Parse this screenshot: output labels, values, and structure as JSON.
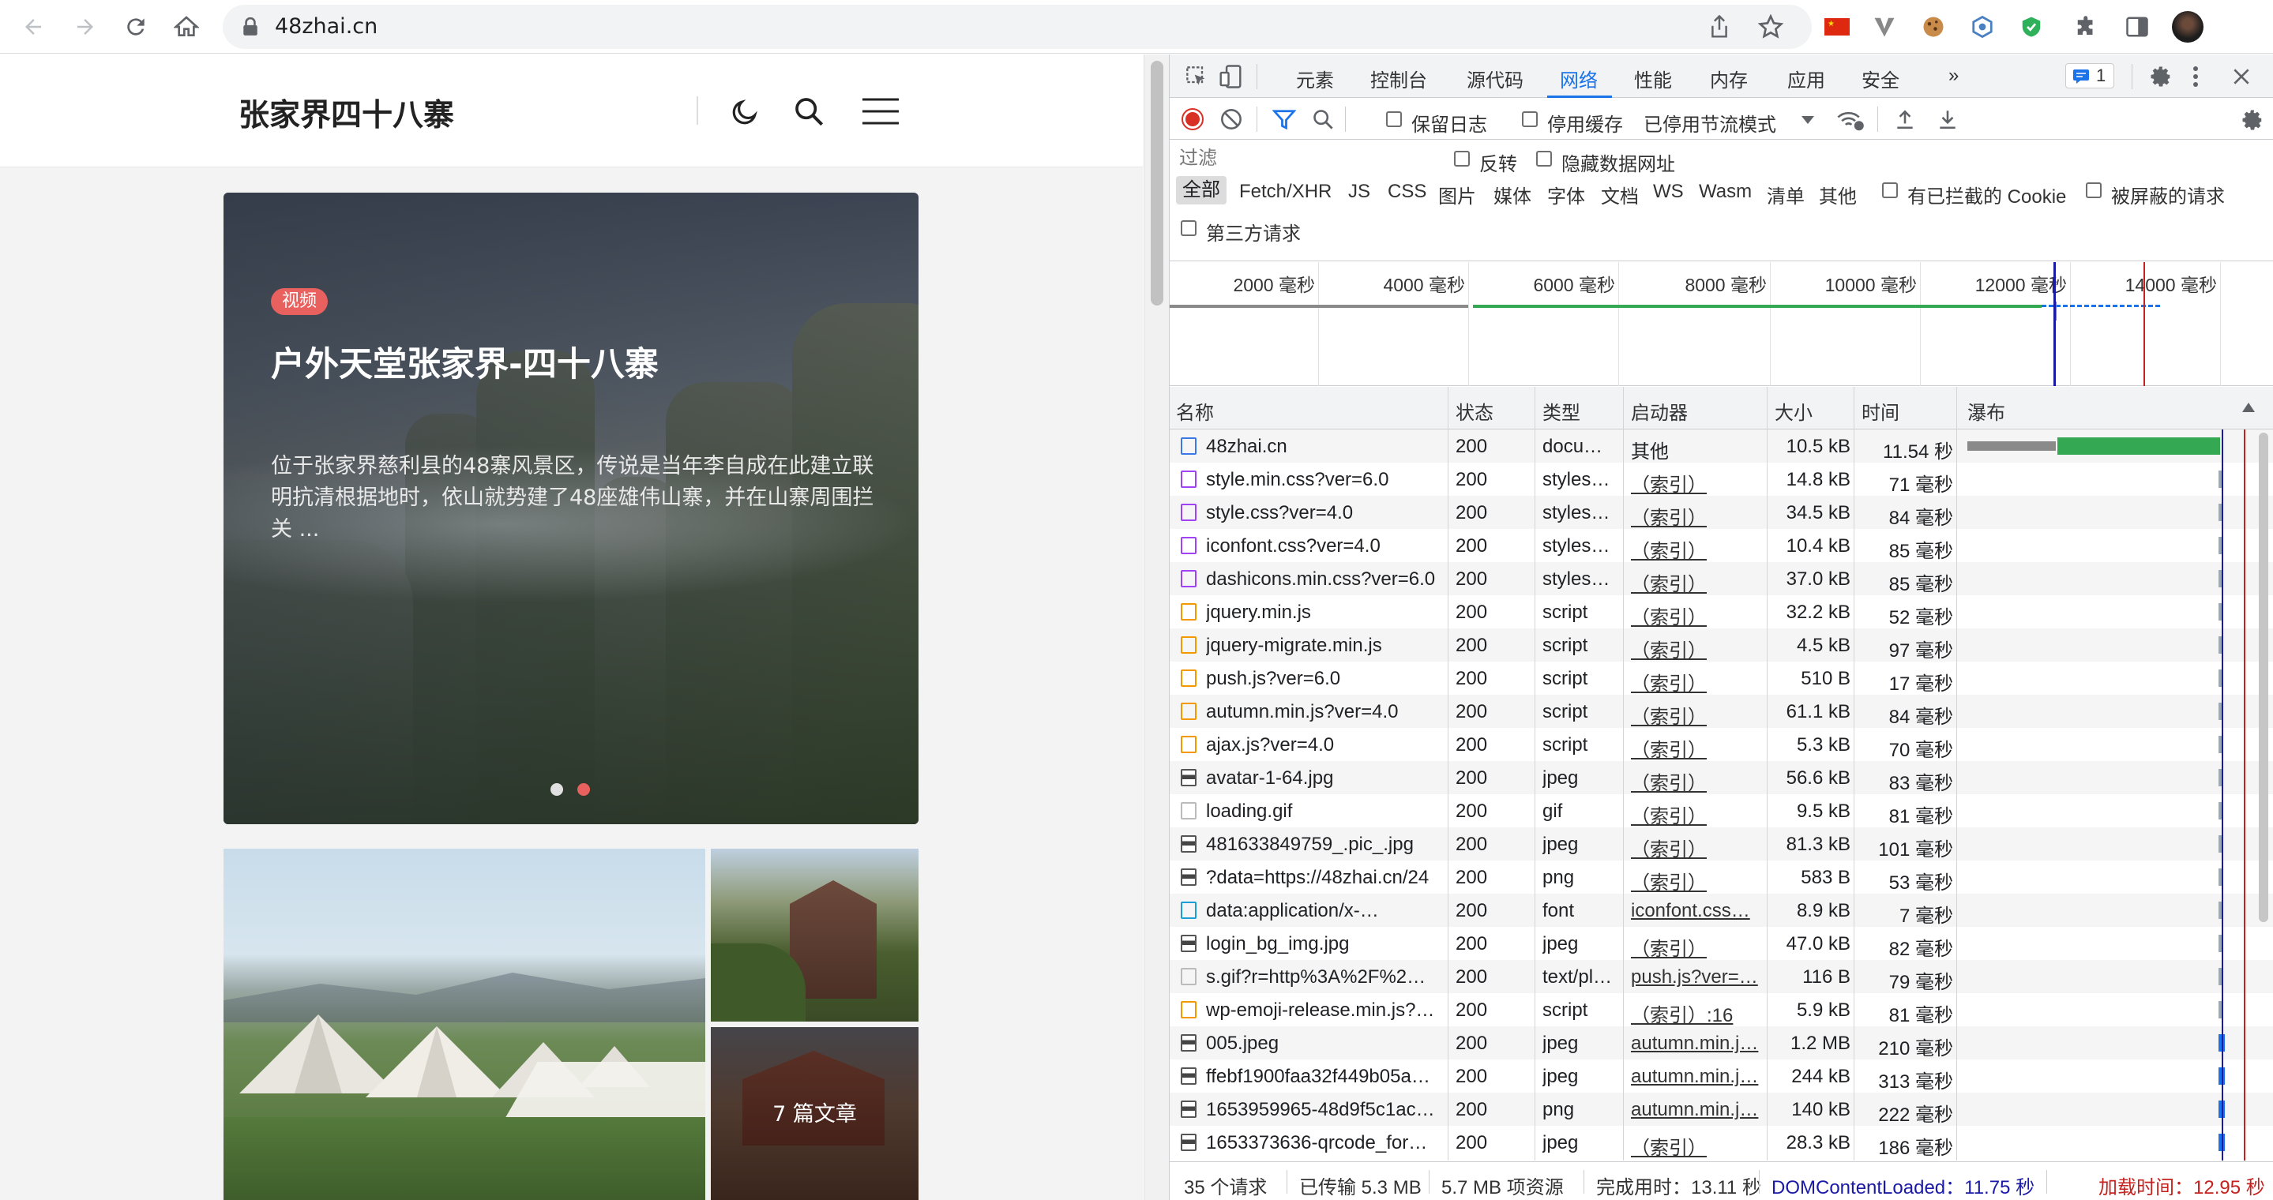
{
  "browser": {
    "url": "48zhai.cn",
    "nav": [
      "back",
      "forward",
      "reload",
      "home"
    ],
    "colors": {
      "toolbar": "#ffffff",
      "omnibox": "#f1f3f4"
    }
  },
  "site": {
    "title": "张家界四十八寨",
    "hero": {
      "tag": "视频",
      "title": "户外天堂张家界-四十八寨",
      "description": "位于张家界慈利县的48寨风景区，传说是当年李自成在此建立联明抗清根据地时，依山就势建了48座雄伟山寨，并在山寨周围拦关 ..."
    },
    "grid_label": "7 篇文章",
    "colors": {
      "tag": "#e8615f",
      "background": "#f3f3f4"
    }
  },
  "devtools": {
    "tabs": [
      "元素",
      "控制台",
      "源代码",
      "网络",
      "性能",
      "内存",
      "应用",
      "安全"
    ],
    "active_tab": "网络",
    "more": "»",
    "issues_count": "1",
    "network_toolbar": {
      "preserve_log": "保留日志",
      "disable_cache": "停用缓存",
      "throttling": "已停用节流模式"
    },
    "filter": {
      "placeholder": "过滤",
      "invert": "反转",
      "hide_data_urls": "隐藏数据网址",
      "types": [
        "全部",
        "Fetch/XHR",
        "JS",
        "CSS",
        "图片",
        "媒体",
        "字体",
        "文档",
        "WS",
        "Wasm",
        "清单",
        "其他"
      ],
      "blocked_cookies": "有已拦截的 Cookie",
      "blocked_requests": "被屏蔽的请求",
      "third_party": "第三方请求"
    },
    "overview_ticks": [
      "2000 毫秒",
      "4000 毫秒",
      "6000 毫秒",
      "8000 毫秒",
      "10000 毫秒",
      "12000 毫秒",
      "14000 毫秒"
    ],
    "columns": [
      "名称",
      "状态",
      "类型",
      "启动器",
      "大小",
      "时间",
      "瀑布"
    ],
    "rows": [
      {
        "name": "48zhai.cn",
        "status": "200",
        "type": "docu…",
        "initiator": "其他",
        "size": "10.5 kB",
        "time": "11.54 秒",
        "kind": "doc"
      },
      {
        "name": "style.min.css?ver=6.0",
        "status": "200",
        "type": "styles…",
        "initiator": "（索引）",
        "size": "14.8 kB",
        "time": "71 毫秒",
        "kind": "css"
      },
      {
        "name": "style.css?ver=4.0",
        "status": "200",
        "type": "styles…",
        "initiator": "（索引）",
        "size": "34.5 kB",
        "time": "84 毫秒",
        "kind": "css"
      },
      {
        "name": "iconfont.css?ver=4.0",
        "status": "200",
        "type": "styles…",
        "initiator": "（索引）",
        "size": "10.4 kB",
        "time": "85 毫秒",
        "kind": "css"
      },
      {
        "name": "dashicons.min.css?ver=6.0",
        "status": "200",
        "type": "styles…",
        "initiator": "（索引）",
        "size": "37.0 kB",
        "time": "85 毫秒",
        "kind": "css"
      },
      {
        "name": "jquery.min.js",
        "status": "200",
        "type": "script",
        "initiator": "（索引）",
        "size": "32.2 kB",
        "time": "52 毫秒",
        "kind": "js"
      },
      {
        "name": "jquery-migrate.min.js",
        "status": "200",
        "type": "script",
        "initiator": "（索引）",
        "size": "4.5 kB",
        "time": "97 毫秒",
        "kind": "js"
      },
      {
        "name": "push.js?ver=6.0",
        "status": "200",
        "type": "script",
        "initiator": "（索引）",
        "size": "510 B",
        "time": "17 毫秒",
        "kind": "js"
      },
      {
        "name": "autumn.min.js?ver=4.0",
        "status": "200",
        "type": "script",
        "initiator": "（索引）",
        "size": "61.1 kB",
        "time": "84 毫秒",
        "kind": "js"
      },
      {
        "name": "ajax.js?ver=4.0",
        "status": "200",
        "type": "script",
        "initiator": "（索引）",
        "size": "5.3 kB",
        "time": "70 毫秒",
        "kind": "js"
      },
      {
        "name": "avatar-1-64.jpg",
        "status": "200",
        "type": "jpeg",
        "initiator": "（索引）",
        "size": "56.6 kB",
        "time": "83 毫秒",
        "kind": "img"
      },
      {
        "name": "loading.gif",
        "status": "200",
        "type": "gif",
        "initiator": "（索引）",
        "size": "9.5 kB",
        "time": "81 毫秒",
        "kind": "blank"
      },
      {
        "name": "481633849759_.pic_.jpg",
        "status": "200",
        "type": "jpeg",
        "initiator": "（索引）",
        "size": "81.3 kB",
        "time": "101 毫秒",
        "kind": "img"
      },
      {
        "name": "?data=https://48zhai.cn/24",
        "status": "200",
        "type": "png",
        "initiator": "（索引）",
        "size": "583 B",
        "time": "53 毫秒",
        "kind": "img"
      },
      {
        "name": "data:application/x-…",
        "status": "200",
        "type": "font",
        "initiator": "iconfont.css…",
        "size": "8.9 kB",
        "time": "7 毫秒",
        "kind": "font"
      },
      {
        "name": "login_bg_img.jpg",
        "status": "200",
        "type": "jpeg",
        "initiator": "（索引）",
        "size": "47.0 kB",
        "time": "82 毫秒",
        "kind": "img"
      },
      {
        "name": "s.gif?r=http%3A%2F%2…",
        "status": "200",
        "type": "text/pl…",
        "initiator": "push.js?ver=…",
        "size": "116 B",
        "time": "79 毫秒",
        "kind": "blank"
      },
      {
        "name": "wp-emoji-release.min.js?…",
        "status": "200",
        "type": "script",
        "initiator": "（索引）:16",
        "size": "5.9 kB",
        "time": "81 毫秒",
        "kind": "js"
      },
      {
        "name": "005.jpeg",
        "status": "200",
        "type": "jpeg",
        "initiator": "autumn.min.j…",
        "size": "1.2 MB",
        "time": "210 毫秒",
        "kind": "img"
      },
      {
        "name": "ffebf1900faa32f449b05a…",
        "status": "200",
        "type": "jpeg",
        "initiator": "autumn.min.j…",
        "size": "244 kB",
        "time": "313 毫秒",
        "kind": "img"
      },
      {
        "name": "1653959965-48d9f5c1ac…",
        "status": "200",
        "type": "png",
        "initiator": "autumn.min.j…",
        "size": "140 kB",
        "time": "222 毫秒",
        "kind": "img"
      },
      {
        "name": "1653373636-qrcode_for…",
        "status": "200",
        "type": "jpeg",
        "initiator": "（索引）",
        "size": "28.3 kB",
        "time": "186 毫秒",
        "kind": "img"
      }
    ],
    "status_bar": {
      "requests": "35 个请求",
      "transferred": "已传输 5.3 MB",
      "resources": "5.7 MB 项资源",
      "finish": "完成用时：13.11 秒",
      "dom_content_loaded": "DOMContentLoaded：11.75 秒",
      "load": "加载时间：12.95 秒"
    },
    "colors": {
      "accent": "#1a73e8",
      "dcl": "#1a1aa6",
      "load": "#c5221f",
      "record": "#d93025",
      "bar_green": "#34a853",
      "bar_gray": "#8a8a8a"
    }
  }
}
